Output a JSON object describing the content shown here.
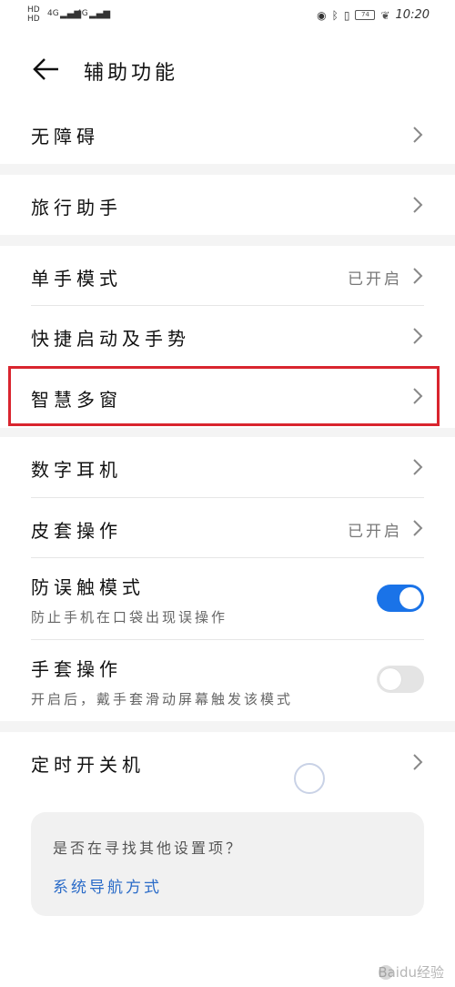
{
  "status_bar": {
    "sim1": "HD",
    "sim2": "HD",
    "signal1": "4G",
    "signal2": "4G",
    "battery": "74",
    "time": "10:20"
  },
  "header": {
    "title": "辅助功能"
  },
  "items": {
    "wuzhangai": {
      "label": "无障碍"
    },
    "lvxing": {
      "label": "旅行助手"
    },
    "danshou": {
      "label": "单手模式",
      "status": "已开启"
    },
    "kuaijie": {
      "label": "快捷启动及手势"
    },
    "zhihui": {
      "label": "智慧多窗"
    },
    "shuzi": {
      "label": "数字耳机"
    },
    "pitao": {
      "label": "皮套操作",
      "status": "已开启"
    },
    "fangwuchu": {
      "label": "防误触模式",
      "sub": "防止手机在口袋出现误操作",
      "enabled": true
    },
    "shoutao": {
      "label": "手套操作",
      "sub": "开启后，戴手套滑动屏幕触发该模式",
      "enabled": false
    },
    "dingshi": {
      "label": "定时开关机"
    }
  },
  "suggestion": {
    "question": "是否在寻找其他设置项？",
    "link": "系统导航方式"
  },
  "watermark": "Baidu经验",
  "colors": {
    "accent": "#1a73e8",
    "highlight": "#d9252e",
    "link": "#2a6bc8"
  }
}
